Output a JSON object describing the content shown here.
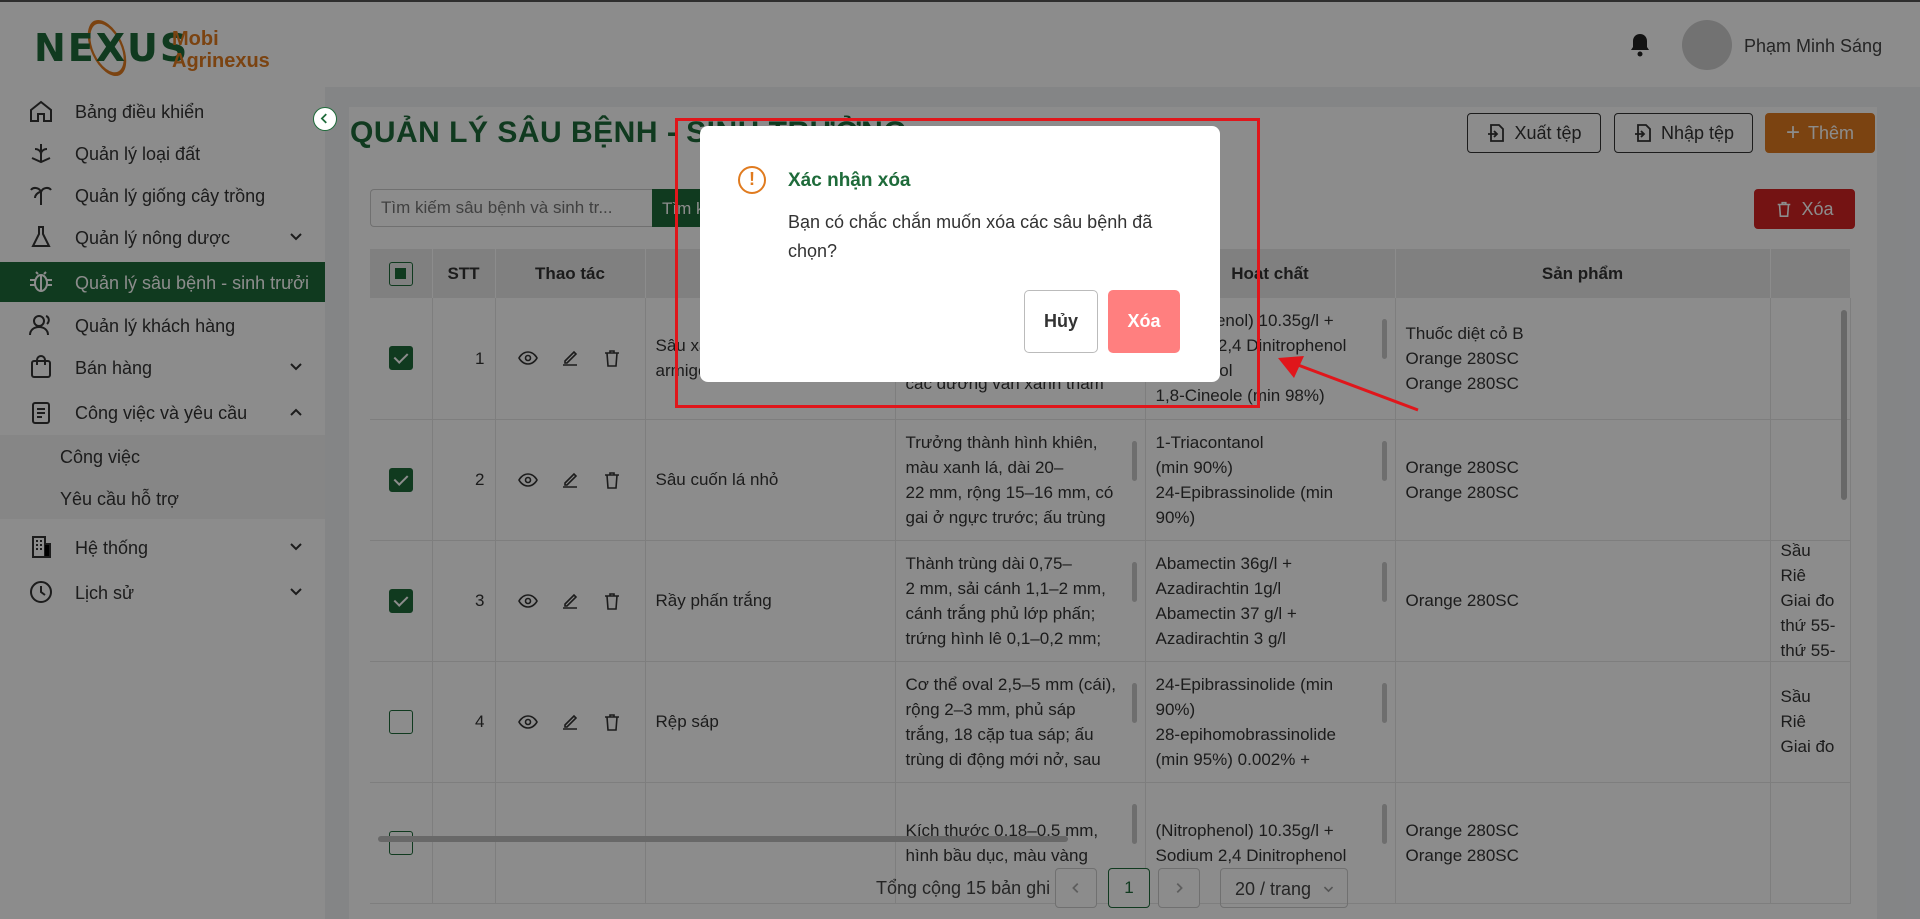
{
  "header": {
    "logo_mark": "NEXUS",
    "logo_line1": "Mobi",
    "logo_line2": "Agrinexus",
    "username": "Phạm Minh Sáng"
  },
  "sidebar": {
    "items": [
      {
        "label": "Bảng điều khiển",
        "icon": "home-icon"
      },
      {
        "label": "Quản lý loại đất",
        "icon": "soil-icon"
      },
      {
        "label": "Quản lý giống cây trồng",
        "icon": "plant-icon"
      },
      {
        "label": "Quản lý nông dược",
        "icon": "flask-icon"
      },
      {
        "label": "Quản lý sâu bệnh - sinh trưởi",
        "icon": "bug-icon"
      },
      {
        "label": "Quản lý khách hàng",
        "icon": "users-icon"
      },
      {
        "label": "Bán hàng",
        "icon": "bag-icon"
      },
      {
        "label": "Công việc và yêu cầu",
        "icon": "clipboard-icon"
      },
      {
        "label": "Hệ thống",
        "icon": "building-icon"
      },
      {
        "label": "Lịch sử",
        "icon": "clock-icon"
      }
    ],
    "subitems": [
      "Công việc",
      "Yêu cầu hỗ trợ"
    ]
  },
  "page": {
    "title": "QUẢN LÝ SÂU BỆNH - SINH TRƯỞNG",
    "export_label": "Xuất tệp",
    "import_label": "Nhập tệp",
    "add_label": "Thêm",
    "delete_label": "Xóa",
    "search_placeholder": "Tìm kiếm sâu bệnh và sinh tr...",
    "search_button": "Tìm kiếm"
  },
  "table": {
    "columns": [
      "STT",
      "Thao tác",
      "Hoạt chất",
      "Sản phẩm"
    ],
    "rows": [
      {
        "checked": true,
        "stt": "1",
        "name": "Sâu xanh da láng ở ngọn\narmigera",
        "desc": "Sâu non màu xanh,\ncó vân xanh đậm\ncác đường vân xanh thẫm",
        "active": "(Nitrophenol) 10.35g/l +\nSodium 2,4 Dinitrophenol\n+ Eugenol\n1,8-Cineole (min 98%)",
        "product": "Thuốc diệt cỏ B\nOrange 280SC\nOrange 280SC",
        "extra": ""
      },
      {
        "checked": true,
        "stt": "2",
        "name": "Sâu cuốn lá nhỏ",
        "desc": "Trưởng thành hình khiên,\nmàu xanh lá, dài 20–\n22 mm, rộng 15–16 mm, có\ngai ở ngực trước; ấu trùng",
        "active": "1-Triacontanol\n(min 90%)\n24-Epibrassinolide (min\n90%)",
        "product": "Orange 280SC\nOrange 280SC",
        "extra": ""
      },
      {
        "checked": true,
        "stt": "3",
        "name": "Rầy phấn trắng",
        "desc": "Thành trùng dài 0,75–\n2 mm, sải cánh 1,1–2 mm,\ncánh trắng phủ lớp phấn;\ntrứng hình lê 0,1–0,2 mm;",
        "active": "Abamectin 36g/l +\nAzadirachtin 1g/l\nAbamectin 37 g/l +\nAzadirachtin 3 g/l",
        "product": "Orange 280SC",
        "extra": "Sầu Riê\nGiai đo\nthứ 55-\nthứ 55-"
      },
      {
        "checked": false,
        "stt": "4",
        "name": "Rệp sáp",
        "desc": "Cơ thể oval 2,5–5 mm (cái),\nrộng 2–3 mm, phủ sáp\ntrắng, 18 cặp tua sáp; ấu\ntrùng di động mới nở, sau",
        "active": "24-Epibrassinolide (min\n90%)\n28-epihomobrassinolide\n(min 95%) 0.002% +",
        "product": "",
        "extra": "Sầu Riê\nGiai đo"
      },
      {
        "checked": false,
        "stt": "",
        "name": "",
        "desc": "Kích thước 0,18–0,5 mm,\nhình bầu dục, màu vàng",
        "active": "(Nitrophenol) 10.35g/l +\nSodium 2,4 Dinitrophenol",
        "product": "Orange 280SC\nOrange 280SC",
        "extra": ""
      }
    ]
  },
  "pagination": {
    "total": "Tổng cộng 15 bản ghi",
    "current": "1",
    "page_size": "20 / trang"
  },
  "modal": {
    "title": "Xác nhận xóa",
    "body": "Bạn có chắc chắn muốn xóa các sâu bệnh đã chọn?",
    "cancel": "Hủy",
    "confirm": "Xóa"
  },
  "colors": {
    "brand_green": "#1e6b3a",
    "accent_orange": "#e07b1f",
    "danger": "#d42323",
    "highlight_red": "#e0161b"
  }
}
